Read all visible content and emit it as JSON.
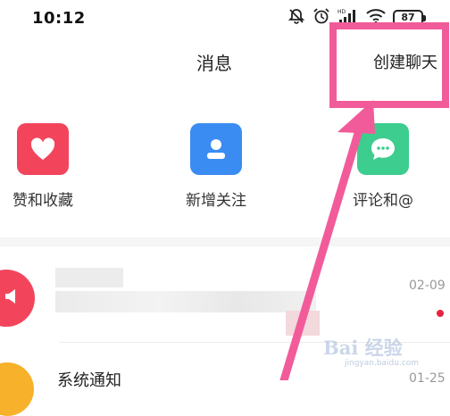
{
  "status_bar": {
    "time": "10:12",
    "battery": "87",
    "icons": [
      "mute-bell-icon",
      "alarm-icon",
      "hd-signal-icon",
      "wifi-icon",
      "battery-icon"
    ]
  },
  "header": {
    "title": "消息",
    "create_chat_label": "创建聊天"
  },
  "quick_actions": [
    {
      "label": "赞和收藏",
      "icon": "heart-icon",
      "color": "#f2455c"
    },
    {
      "label": "新增关注",
      "icon": "person-icon",
      "color": "#3b8cf2"
    },
    {
      "label": "评论和@",
      "icon": "chat-bubble-icon",
      "color": "#3ccd8f"
    }
  ],
  "messages": [
    {
      "title": "",
      "date": "02-09",
      "avatar_icon": "speaker-icon",
      "avatar_color": "#f2455c",
      "unread": true
    },
    {
      "title": "系统通知",
      "date": "01-25",
      "avatar_color": "#f7b12a"
    }
  ],
  "annotation": {
    "color": "#f25b9a"
  },
  "watermark": {
    "logo": "Bai 经验",
    "sub": "jingyan.baidu.com"
  }
}
